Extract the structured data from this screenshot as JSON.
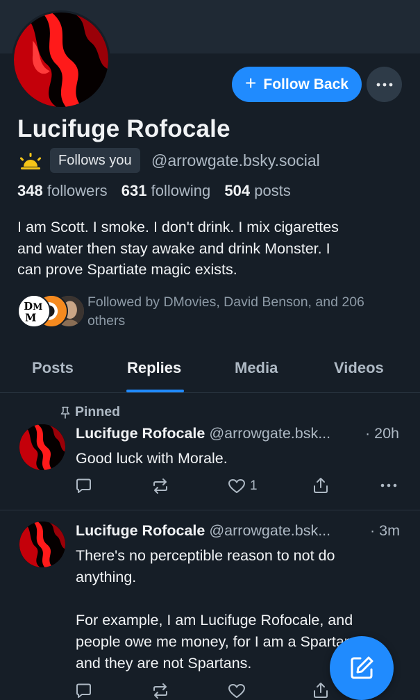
{
  "profile": {
    "display_name": "Lucifuge Rofocale",
    "follows_you_label": "Follows you",
    "handle": "@arrowgate.bsky.social",
    "followers_count": "348",
    "followers_label": "followers",
    "following_count": "631",
    "following_label": "following",
    "posts_count": "504",
    "posts_label": "posts",
    "bio_lines": [
      "I am Scott.  I smoke.  I don't drink.  I mix cigarettes",
      "and water then stay awake and drink Monster.  I",
      "can prove Spartiate magic exists."
    ],
    "followed_by_lines": [
      "Followed by DMovies, David Benson, and 206",
      "others"
    ],
    "avatar_icon": "red-figure-avatar",
    "badge_icon": "sunrise-icon"
  },
  "actions": {
    "follow_back_label": "Follow Back",
    "more_icon": "ellipsis-icon"
  },
  "tabs": [
    {
      "label": "Posts",
      "active": false
    },
    {
      "label": "Replies",
      "active": true
    },
    {
      "label": "Media",
      "active": false
    },
    {
      "label": "Videos",
      "active": false
    }
  ],
  "posts": [
    {
      "pinned_label": "Pinned",
      "author": "Lucifuge Rofocale",
      "handle": "@arrowgate.bsk...",
      "time": "· 20h",
      "lines": [
        "Good luck with Morale."
      ],
      "like_count": "1"
    },
    {
      "author": "Lucifuge Rofocale",
      "handle": "@arrowgate.bsk...",
      "time": "· 3m",
      "lines": [
        "There's no perceptible reason to not do",
        "anything.",
        "",
        "For example, I am Lucifuge Rofocale, and",
        "people owe me money, for I am a Spartan",
        "and they are not Spartans."
      ]
    }
  ],
  "colors": {
    "background": "#161e27",
    "accent": "#208bfe",
    "muted_text": "#aeb9c4"
  }
}
